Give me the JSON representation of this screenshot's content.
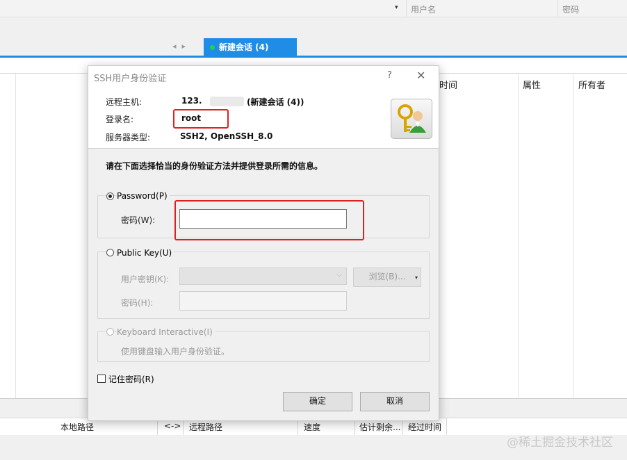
{
  "background": {
    "top_columns": [
      "用户名",
      "密码"
    ],
    "tab_label": "新建会话 (4)",
    "file_headers": [
      "时间",
      "属性",
      "所有者"
    ],
    "queue_headers": [
      "本地路径",
      "<->",
      "远程路径",
      "速度",
      "估计剩余...",
      "经过时间"
    ],
    "watermark": "@稀土掘金技术社区"
  },
  "dialog": {
    "title": "SSH用户身份验证",
    "help": "?",
    "close": "✕",
    "remote_host_label": "远程主机:",
    "remote_host_value": "123.",
    "remote_host_suffix": "(新建会话 (4))",
    "login_label": "登录名:",
    "login_value": "root",
    "server_type_label": "服务器类型:",
    "server_type_value": "SSH2, OpenSSH_8.0",
    "instruction": "请在下面选择恰当的身份验证方法并提供登录所需的信息。",
    "password_option": "Password(P)",
    "password_label": "密码(W):",
    "password_value": "",
    "pubkey_option": "Public Key(U)",
    "user_key_label": "用户密钥(K):",
    "browse_button": "浏览(B)...",
    "passphrase_label": "密码(H):",
    "keyboard_option": "Keyboard Interactive(I)",
    "keyboard_desc": "使用键盘输入用户身份验证。",
    "remember_password": "记住密码(R)",
    "ok_button": "确定",
    "cancel_button": "取消"
  },
  "colors": {
    "accent": "#1f8ce6",
    "highlight": "#e02020"
  }
}
